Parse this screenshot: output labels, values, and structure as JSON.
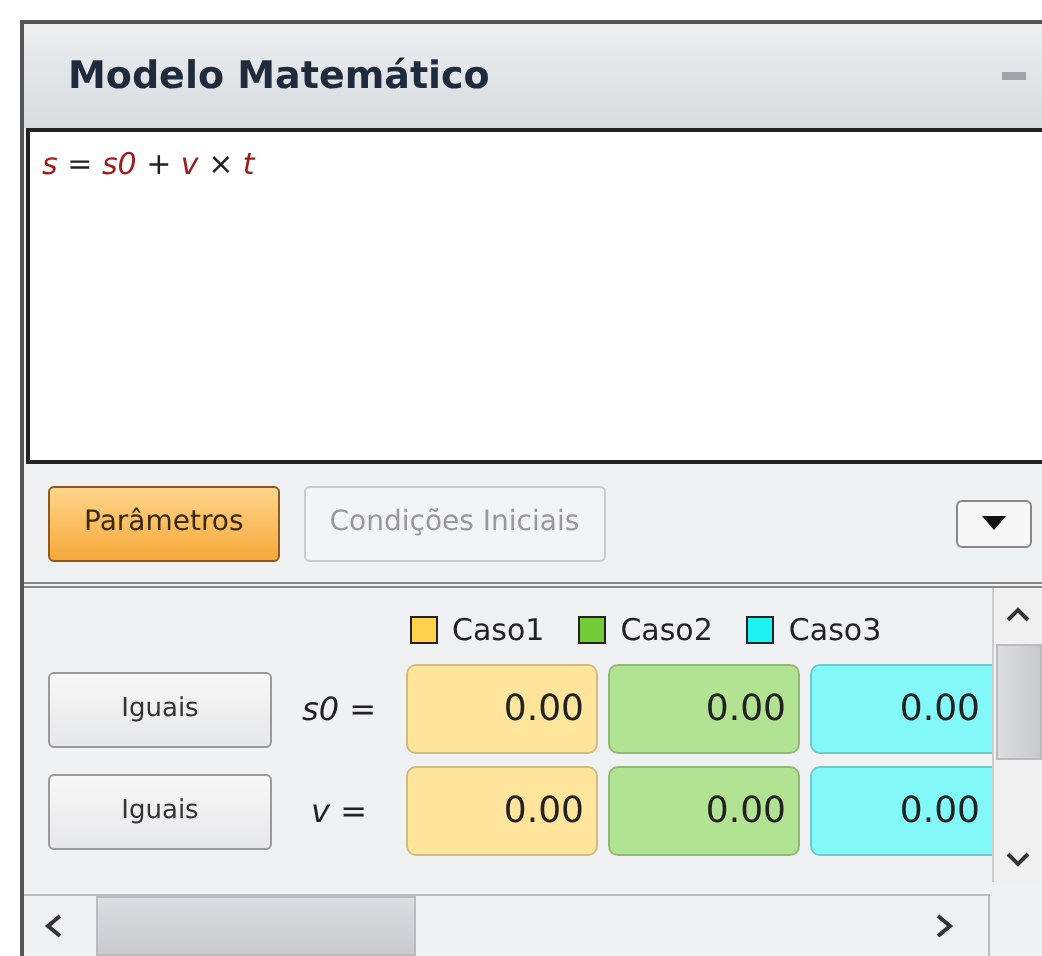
{
  "panel": {
    "title": "Modelo Matemático"
  },
  "formula": "*s* = *s0* + *v* × *t*",
  "tabs": [
    {
      "label": "Parâmetros",
      "selected": true
    },
    {
      "label": "Condições Iniciais",
      "selected": false
    }
  ],
  "cases": [
    {
      "name": "Caso1",
      "color": "#ffd04a"
    },
    {
      "name": "Caso2",
      "color": "#72cc38"
    },
    {
      "name": "Caso3",
      "color": "#1ef2f2"
    }
  ],
  "parameters": [
    {
      "button": "Iguais",
      "label": "*s0* =",
      "values": [
        "0.00",
        "0.00",
        "0.00"
      ]
    },
    {
      "button": "Iguais",
      "label": "*v* =",
      "values": [
        "0.00",
        "0.00",
        "0.00"
      ]
    }
  ]
}
